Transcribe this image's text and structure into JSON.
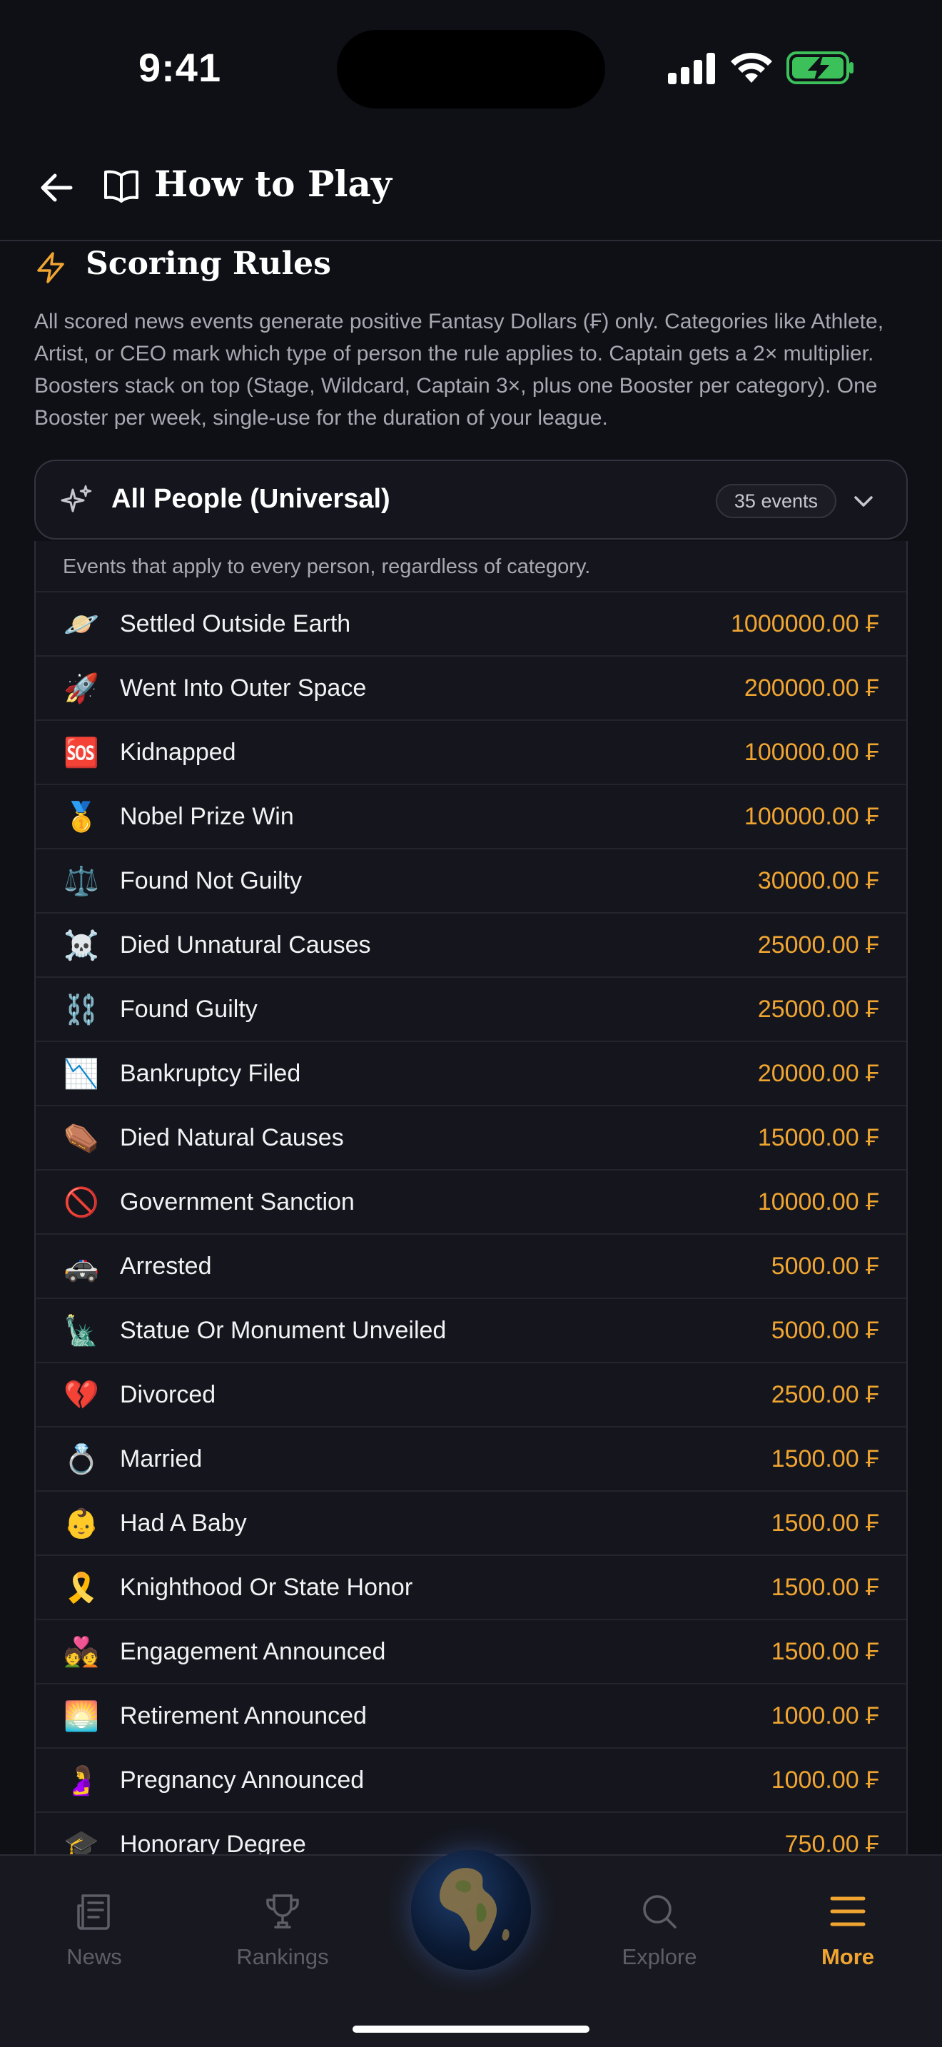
{
  "status_bar": {
    "time": "9:41"
  },
  "header": {
    "title": "How to Play"
  },
  "section": {
    "title": "Scoring Rules",
    "description": "All scored news events generate positive Fantasy Dollars (₣) only. Categories like Athlete, Artist, or CEO mark which type of person the rule applies to. Captain gets a 2× multiplier. Boosters stack on top (Stage, Wildcard, Captain 3×, plus one Booster per category). One Booster per week, single-use for the duration of your league."
  },
  "category": {
    "title": "All People (Universal)",
    "count": "35 events",
    "intro": "Events that apply to every person, regardless of category.",
    "events": [
      {
        "icon": "🪐",
        "label": "Settled Outside Earth",
        "value": "1000000.00 ₣"
      },
      {
        "icon": "🚀",
        "label": "Went Into Outer Space",
        "value": "200000.00 ₣"
      },
      {
        "icon": "🆘",
        "label": "Kidnapped",
        "value": "100000.00 ₣"
      },
      {
        "icon": "🥇",
        "label": "Nobel Prize Win",
        "value": "100000.00 ₣"
      },
      {
        "icon": "⚖️",
        "label": "Found Not Guilty",
        "value": "30000.00 ₣"
      },
      {
        "icon": "☠️",
        "label": "Died Unnatural Causes",
        "value": "25000.00 ₣"
      },
      {
        "icon": "⛓️",
        "label": "Found Guilty",
        "value": "25000.00 ₣"
      },
      {
        "icon": "📉",
        "label": "Bankruptcy Filed",
        "value": "20000.00 ₣"
      },
      {
        "icon": "⚰️",
        "label": "Died Natural Causes",
        "value": "15000.00 ₣"
      },
      {
        "icon": "🚫",
        "label": "Government Sanction",
        "value": "10000.00 ₣"
      },
      {
        "icon": "🚓",
        "label": "Arrested",
        "value": "5000.00 ₣"
      },
      {
        "icon": "🗽",
        "label": "Statue Or Monument Unveiled",
        "value": "5000.00 ₣"
      },
      {
        "icon": "💔",
        "label": "Divorced",
        "value": "2500.00 ₣"
      },
      {
        "icon": "💍",
        "label": "Married",
        "value": "1500.00 ₣"
      },
      {
        "icon": "👶",
        "label": "Had A Baby",
        "value": "1500.00 ₣"
      },
      {
        "icon": "🎗️",
        "label": "Knighthood Or State Honor",
        "value": "1500.00 ₣"
      },
      {
        "icon": "💑",
        "label": "Engagement Announced",
        "value": "1500.00 ₣"
      },
      {
        "icon": "🌅",
        "label": "Retirement Announced",
        "value": "1000.00 ₣"
      },
      {
        "icon": "🤰",
        "label": "Pregnancy Announced",
        "value": "1000.00 ₣"
      },
      {
        "icon": "🎓",
        "label": "Honorary Degree",
        "value": "750.00 ₣"
      }
    ]
  },
  "tabbar": {
    "news": "News",
    "rankings": "Rankings",
    "explore": "Explore",
    "more": "More"
  },
  "colors": {
    "accent": "#f0a531",
    "background": "#0f1016",
    "card": "#15161d"
  }
}
